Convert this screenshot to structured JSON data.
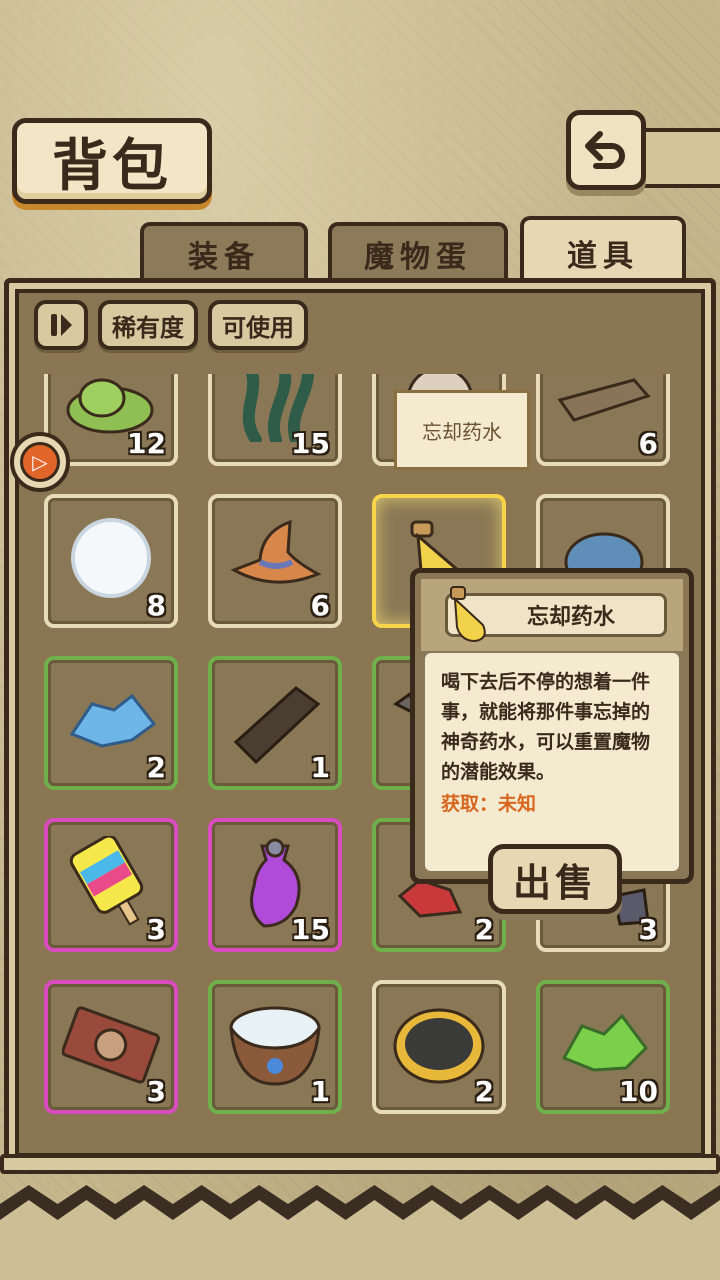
{
  "header": {
    "title": "背包",
    "back_icon": "back-arrow-icon"
  },
  "tabs": [
    {
      "label": "装备",
      "active": false
    },
    {
      "label": "魔物蛋",
      "active": false
    },
    {
      "label": "道具",
      "active": true
    }
  ],
  "filters": {
    "sort_icon": "sort-toggle-icon",
    "rarity": "稀有度",
    "usable": "可使用"
  },
  "items": [
    {
      "icon": "slime-icon",
      "count": "12",
      "rarity": "common"
    },
    {
      "icon": "seaweed-icon",
      "count": "15",
      "rarity": "common"
    },
    {
      "icon": "potion-icon",
      "count": "",
      "rarity": "common"
    },
    {
      "icon": "wood-plank-icon",
      "count": "6",
      "rarity": "common"
    },
    {
      "icon": "snowball-icon",
      "count": "8",
      "rarity": "common"
    },
    {
      "icon": "witch-hat-icon",
      "count": "6",
      "rarity": "common"
    },
    {
      "icon": "forget-potion-icon",
      "count": "",
      "rarity": "selected"
    },
    {
      "icon": "shell-icon",
      "count": "",
      "rarity": "common"
    },
    {
      "icon": "ice-crystal-icon",
      "count": "2",
      "rarity": "uncommon"
    },
    {
      "icon": "dark-wood-icon",
      "count": "1",
      "rarity": "uncommon"
    },
    {
      "icon": "stone-icon",
      "count": "",
      "rarity": "uncommon"
    },
    {
      "icon": "ore-icon",
      "count": "",
      "rarity": "uncommon"
    },
    {
      "icon": "popsicle-icon",
      "count": "3",
      "rarity": "epic"
    },
    {
      "icon": "purple-vase-icon",
      "count": "15",
      "rarity": "epic"
    },
    {
      "icon": "red-crystal-icon",
      "count": "2",
      "rarity": "uncommon"
    },
    {
      "icon": "iron-chunk-icon",
      "count": "3",
      "rarity": "common"
    },
    {
      "icon": "ticket-icon",
      "count": "3",
      "rarity": "epic"
    },
    {
      "icon": "bowl-icon",
      "count": "1",
      "rarity": "uncommon"
    },
    {
      "icon": "pie-icon",
      "count": "2",
      "rarity": "common"
    },
    {
      "icon": "green-crystal-icon",
      "count": "10",
      "rarity": "uncommon"
    }
  ],
  "hover_label": "忘却药水",
  "tooltip": {
    "name": "忘却药水",
    "description": "喝下去后不停的想着一件事，就能将那件事忘掉的神奇药水，可以重置魔物的潜能效果。",
    "obtain": "获取：未知",
    "sell_label": "出售"
  },
  "colors": {
    "common": "#e8dcb8",
    "uncommon": "#6fb04a",
    "epic": "#d84cc0",
    "selected": "#f7d44a",
    "obtain_text": "#d8661e"
  }
}
